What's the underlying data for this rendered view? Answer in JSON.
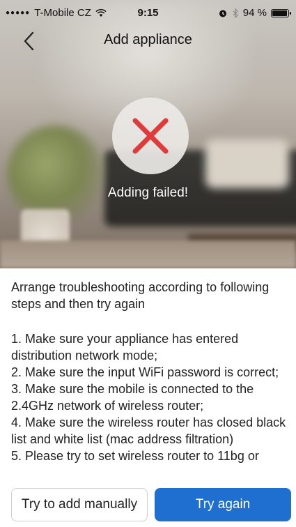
{
  "status_bar": {
    "carrier": "T-Mobile CZ",
    "time": "9:15",
    "battery": "94 %",
    "battery_level": 0.94
  },
  "nav": {
    "title": "Add appliance"
  },
  "result": {
    "message": "Adding failed!",
    "icon": "close-icon",
    "icon_color": "#e03b3b"
  },
  "instructions": {
    "intro": "Arrange troubleshooting according to following steps and then try again",
    "steps": [
      "1. Make sure your appliance has entered distribution network mode;",
      "2. Make sure the input WiFi password is correct;",
      "3. Make sure the mobile is connected to the 2.4GHz network of wireless router;",
      "4. Make sure the wireless router has closed black list and white list (mac address filtration)",
      "5. Please try to set wireless router to 11bg or"
    ]
  },
  "actions": {
    "manual_label": "Try to add manually",
    "retry_label": "Try again",
    "primary_color": "#1f6fd0"
  }
}
